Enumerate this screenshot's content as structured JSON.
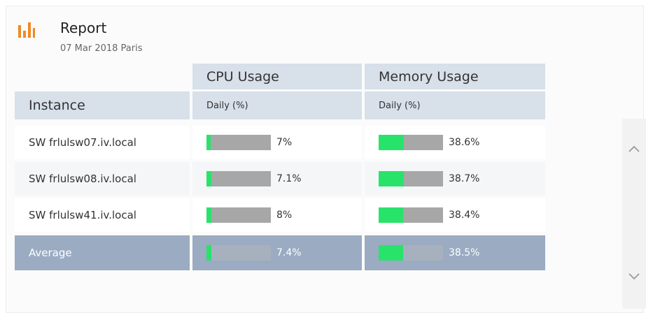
{
  "report": {
    "icon": "bar-chart-icon",
    "title": "Report",
    "subtitle": "07 Mar 2018 Paris"
  },
  "table": {
    "headers": {
      "instance": "Instance",
      "cpu_usage": "CPU Usage",
      "cpu_sub": "Daily (%)",
      "memory_usage": "Memory Usage",
      "memory_sub": "Daily (%)"
    },
    "rows": [
      {
        "instance": "SW frlulsw07.iv.local",
        "cpu_label": "7%",
        "cpu_value": 7,
        "mem_label": "38.6%",
        "mem_value": 38.6
      },
      {
        "instance": "SW frlulsw08.iv.local",
        "cpu_label": "7.1%",
        "cpu_value": 7.1,
        "mem_label": "38.7%",
        "mem_value": 38.7
      },
      {
        "instance": "SW frlulsw41.iv.local",
        "cpu_label": "8%",
        "cpu_value": 8,
        "mem_label": "38.4%",
        "mem_value": 38.4
      }
    ],
    "average": {
      "label": "Average",
      "cpu_label": "7.4%",
      "cpu_value": 7.4,
      "mem_label": "38.5%",
      "mem_value": 38.5
    }
  },
  "colors": {
    "accent": "#f08a24",
    "header_bg": "#d8e0ea",
    "average_bg": "#9aabc2",
    "bar_fill": "#28e36a",
    "bar_track": "#a7a7a7"
  },
  "scrollbar": {
    "up_icon": "chevron-up-icon",
    "down_icon": "chevron-down-icon"
  }
}
